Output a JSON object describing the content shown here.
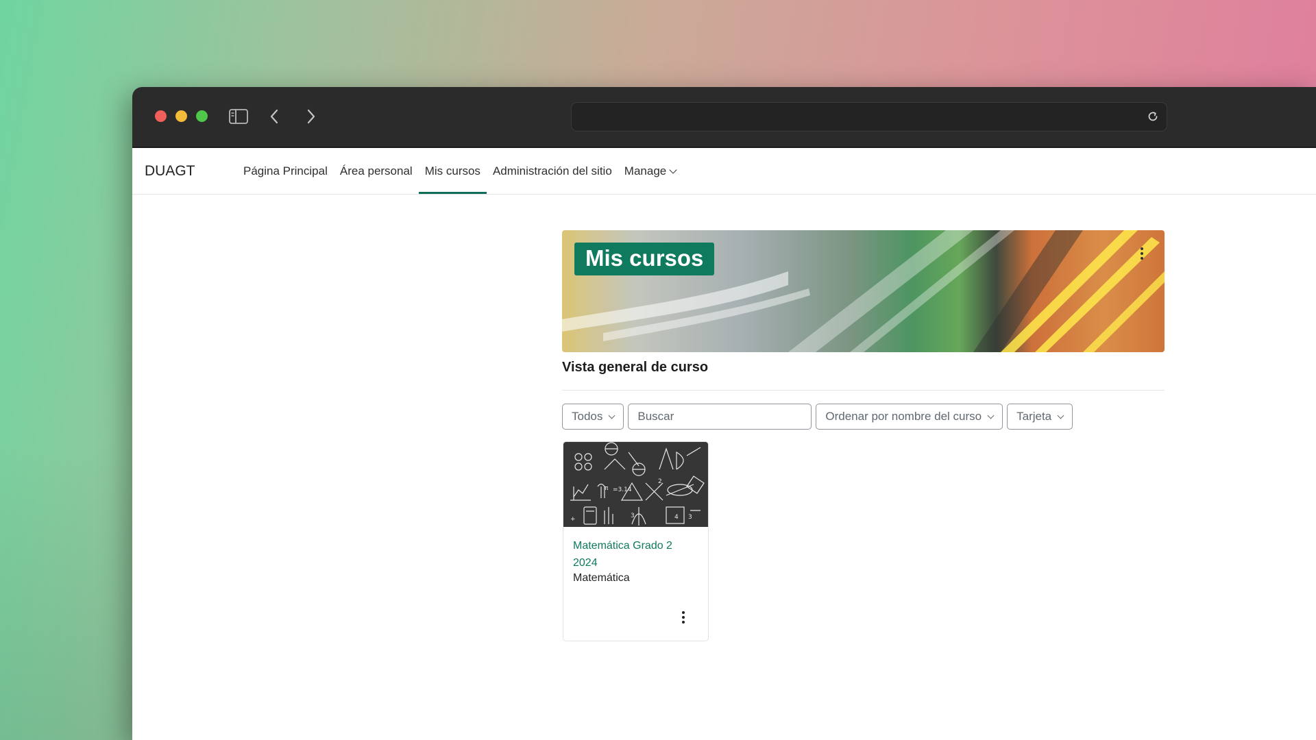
{
  "navbar": {
    "brand": "DUAGT",
    "items": [
      {
        "label": "Página Principal"
      },
      {
        "label": "Área personal"
      },
      {
        "label": "Mis cursos",
        "active": true
      },
      {
        "label": "Administración del sitio"
      },
      {
        "label": "Manage"
      }
    ]
  },
  "banner": {
    "title": "Mis cursos"
  },
  "overview": {
    "title": "Vista general de curso",
    "filter_label": "Todos",
    "search_placeholder": "Buscar",
    "sort_label": "Ordenar por nombre del curso",
    "view_label": "Tarjeta"
  },
  "courses": [
    {
      "name": "Matemática Grado 2 2024",
      "category": "Matemática"
    }
  ],
  "colors": {
    "accent": "#0f7a5e",
    "titlebar": "#2b2b2b"
  },
  "icons": [
    "sidebar-icon",
    "back-icon",
    "forward-icon",
    "reload-icon",
    "kebab-icon",
    "chevron-down-icon"
  ]
}
